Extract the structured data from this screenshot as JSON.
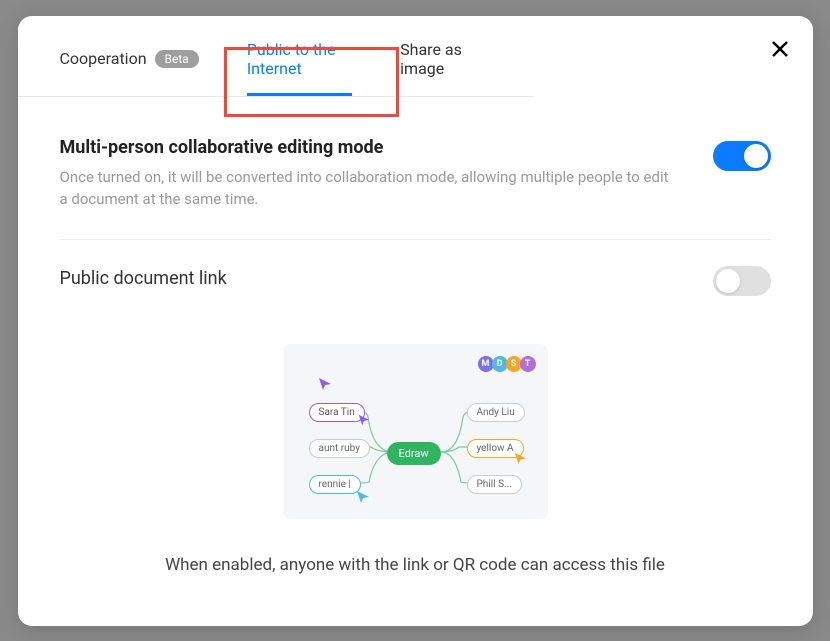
{
  "tabs": {
    "cooperation": {
      "label": "Cooperation",
      "badge": "Beta"
    },
    "public": {
      "label": "Public to the Internet"
    },
    "share_image": {
      "label": "Share as image"
    }
  },
  "sections": {
    "collab": {
      "title": "Multi-person collaborative editing mode",
      "desc": "Once turned on, it will be converted into collaboration mode, allowing multiple people to edit a document at the same time.",
      "toggle_on": true
    },
    "public_link": {
      "label": "Public document link",
      "toggle_on": false
    }
  },
  "hint": "When enabled, anyone with the link or QR code can access this file",
  "illustration": {
    "avatars": [
      {
        "letter": "M",
        "color": "#7c6ff0"
      },
      {
        "letter": "D",
        "color": "#4fb8e8"
      },
      {
        "letter": "S",
        "color": "#f5a623"
      },
      {
        "letter": "T",
        "color": "#b06fd8"
      }
    ],
    "center": "Edraw",
    "nodes": {
      "sara": "Sara Tin",
      "aunt": "aunt ruby",
      "rennie": "rennie |",
      "andy": "Andy Liu",
      "yellow": "yellow A",
      "phill": "Phill S..."
    }
  }
}
